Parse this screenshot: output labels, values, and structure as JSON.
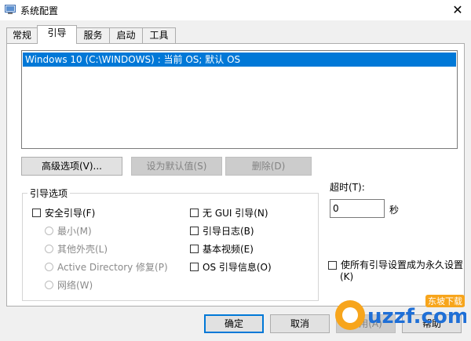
{
  "window": {
    "title": "系统配置",
    "close": "✕"
  },
  "tabs": [
    {
      "label": "常规",
      "active": false
    },
    {
      "label": "引导",
      "active": true
    },
    {
      "label": "服务",
      "active": false
    },
    {
      "label": "启动",
      "active": false
    },
    {
      "label": "工具",
      "active": false
    }
  ],
  "os_list": {
    "items": [
      "Windows 10 (C:\\WINDOWS) : 当前 OS; 默认 OS"
    ],
    "selected_index": 0
  },
  "buttons": {
    "advanced": "高级选项(V)...",
    "set_default": "设为默认值(S)",
    "delete": "删除(D)"
  },
  "boot_options": {
    "title": "引导选项",
    "safe_boot": "安全引导(F)",
    "minimal": "最小(M)",
    "alternate_shell": "其他外壳(L)",
    "active_directory": "Active Directory 修复(P)",
    "network": "网络(W)",
    "no_gui": "无 GUI 引导(N)",
    "boot_log": "引导日志(B)",
    "base_video": "基本视频(E)",
    "os_boot_info": "OS 引导信息(O)"
  },
  "timeout": {
    "label": "超时(T):",
    "value": "0",
    "unit": "秒"
  },
  "permanent": {
    "line1": "使所有引导设置成为永久设置",
    "line2": "(K)"
  },
  "footer": {
    "ok": "确定",
    "cancel": "取消",
    "apply": "应用(A)",
    "help": "帮助"
  },
  "watermark": {
    "text": "uzzf.com",
    "tag": "东坡下载"
  }
}
